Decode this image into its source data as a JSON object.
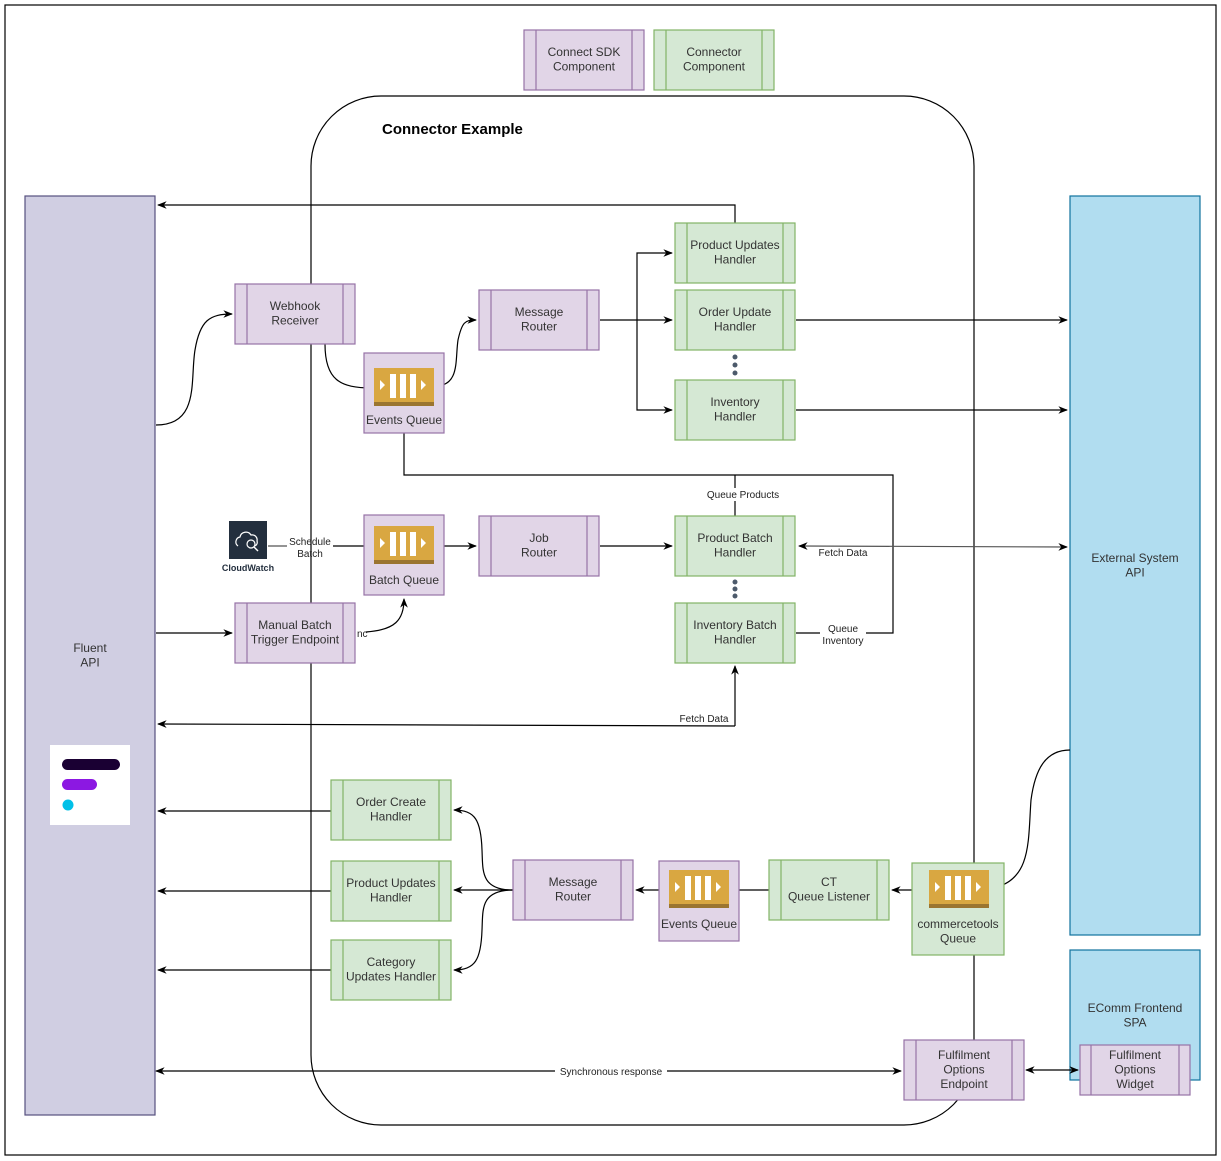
{
  "legend": {
    "sdk_component": "Connect SDK\nComponent",
    "connector_component": "Connector\nComponent"
  },
  "container": {
    "title": "Connector Example"
  },
  "colors": {
    "sdk_fill": "#e1d5e7",
    "sdk_stroke": "#9673a6",
    "connector_fill": "#d5e8d4",
    "connector_stroke": "#82b366",
    "fluent_fill": "#d0cee2",
    "fluent_stroke": "#56517e",
    "external_fill": "#b1ddf0",
    "external_stroke": "#10739e",
    "queue_icon": "#d9a741",
    "cloudwatch_bg": "#232f3e"
  },
  "systems": {
    "fluent_api": "Fluent\nAPI",
    "external_api": "External System\nAPI",
    "ecomm_frontend": "EComm Frontend\nSPA"
  },
  "nodes": {
    "webhook_receiver": "Webhook\nReceiver",
    "events_queue_top": "Events Queue",
    "message_router_top": "Message\nRouter",
    "product_updates_handler_top": "Product Updates\nHandler",
    "order_update_handler": "Order Update\nHandler",
    "inventory_handler": "Inventory\nHandler",
    "cloudwatch": "CloudWatch",
    "batch_queue": "Batch Queue",
    "job_router": "Job\nRouter",
    "manual_batch_trigger": "Manual Batch\nTrigger Endpoint",
    "product_batch_handler": "Product Batch\nHandler",
    "inventory_batch_handler": "Inventory Batch\nHandler",
    "order_create_handler": "Order Create\nHandler",
    "product_updates_handler_bottom": "Product Updates\nHandler",
    "category_updates_handler": "Category\nUpdates Handler",
    "message_router_bottom": "Message\nRouter",
    "events_queue_bottom": "Events Queue",
    "ct_queue_listener": "CT\nQueue Listener",
    "commercetools_queue": "commercetools\nQueue",
    "fulfilment_options_endpoint": "Fulfilment\nOptions\nEndpoint",
    "fulfilment_options_widget": "Fulfilment\nOptions\nWidget"
  },
  "edge_labels": {
    "schedule_batch": "Schedule\nBatch",
    "async_fragment": "nc",
    "queue_products": "Queue Products",
    "fetch_data_right": "Fetch Data",
    "queue_inventory": "Queue\nInventory",
    "fetch_data_bottom": "Fetch Data",
    "synchronous_response": "Synchronous response"
  }
}
